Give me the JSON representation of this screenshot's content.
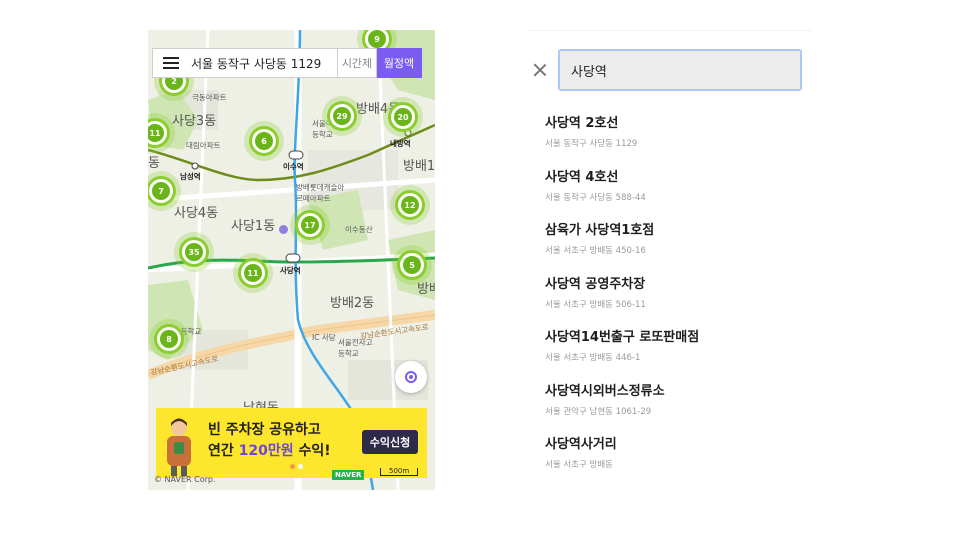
{
  "map": {
    "address": "서울 동작구 사당동 1129",
    "segment_hourly": "시간제",
    "segment_monthly": "월정액",
    "clusters": [
      "2",
      "9",
      "11",
      "6",
      "29",
      "20",
      "7",
      "12",
      "17",
      "35",
      "11",
      "5",
      "8"
    ],
    "district_labels": [
      "사당3동",
      "사당4동",
      "사당1동",
      "방배4동",
      "방배2동",
      "방배1",
      "방배",
      "남현동",
      "동"
    ],
    "poi_labels": [
      "극동아파트",
      "대림아파트",
      "서울이수고등학교",
      "방배롯데캐슬아르떼아파트",
      "서울전자고등학교",
      "이수동산",
      "남사초등학교",
      "강남순환도시고속도로",
      "강남순환도시고속도로",
      "IC 사당"
    ],
    "station_labels": [
      "남성역",
      "이수역",
      "사당역",
      "내방역"
    ],
    "copyright": "© NAVER Corp.",
    "scale": "500m"
  },
  "banner": {
    "line1": "빈 주차장 공유하고",
    "line2_prefix": "연간 ",
    "line2_highlight": "120만원",
    "line2_suffix": " 수익!",
    "button": "수익신청",
    "badge": "NAVER"
  },
  "search": {
    "query": "사당역"
  },
  "results": [
    {
      "title": "사당역 2호선",
      "address": "서울 동작구 사당동 1129"
    },
    {
      "title": "사당역 4호선",
      "address": "서울 동작구 사당동 588-44"
    },
    {
      "title": "삼육가 사당역1호점",
      "address": "서울 서초구 방배동 450-16"
    },
    {
      "title": "사당역 공영주차장",
      "address": "서울 서초구 방배동 506-11"
    },
    {
      "title": "사당역14번출구 로또판매점",
      "address": "서울 서초구 방배동 446-1"
    },
    {
      "title": "사당역시외버스정류소",
      "address": "서울 관악구 남현동 1061-29"
    },
    {
      "title": "사당역사거리",
      "address": "서울 서초구 방배동"
    }
  ],
  "colors": {
    "accent": "#7b5cf0",
    "cluster": "#8ccd2e",
    "banner": "#fde62b",
    "search_border": "#aac8f2"
  }
}
